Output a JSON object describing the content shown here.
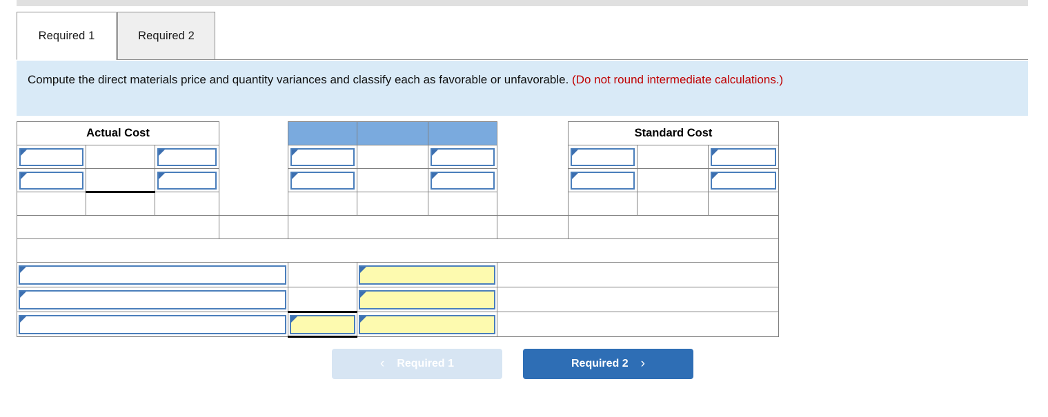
{
  "window": {
    "top_strip": "",
    "tabs": [
      {
        "label": "Required 1",
        "state": "active"
      },
      {
        "label": "Required 2",
        "state": "inactive"
      }
    ]
  },
  "instruction": {
    "text": "Compute the direct materials price and quantity variances and classify each as favorable or unfavorable.",
    "note": "(Do not round intermediate calculations.)"
  },
  "worksheet": {
    "headers": {
      "actual_cost": "Actual Cost",
      "standard_cost": "Standard Cost",
      "blank1": "",
      "blank2": "",
      "blank3": "",
      "spacer1": "",
      "spacer2": ""
    },
    "rows": [
      {
        "name": "input-row-1",
        "cells": [
          {
            "type": "input",
            "value": ""
          },
          {
            "type": "blank",
            "value": ""
          },
          {
            "type": "input",
            "value": ""
          },
          {
            "type": "gap",
            "value": ""
          },
          {
            "type": "input",
            "value": ""
          },
          {
            "type": "blank",
            "value": ""
          },
          {
            "type": "input",
            "value": ""
          },
          {
            "type": "gap",
            "value": ""
          },
          {
            "type": "input",
            "value": ""
          },
          {
            "type": "blank",
            "value": ""
          },
          {
            "type": "input",
            "value": ""
          }
        ]
      },
      {
        "name": "input-row-2",
        "cells": [
          {
            "type": "input",
            "value": ""
          },
          {
            "type": "blank",
            "value": ""
          },
          {
            "type": "input",
            "value": ""
          },
          {
            "type": "gap",
            "value": ""
          },
          {
            "type": "input",
            "value": ""
          },
          {
            "type": "blank",
            "value": ""
          },
          {
            "type": "input",
            "value": ""
          },
          {
            "type": "gap",
            "value": ""
          },
          {
            "type": "input",
            "value": ""
          },
          {
            "type": "blank",
            "value": ""
          },
          {
            "type": "input",
            "value": ""
          }
        ]
      },
      {
        "name": "subtotal-row",
        "cells": [
          {
            "type": "blank",
            "value": ""
          },
          {
            "type": "blank-underlined",
            "value": ""
          },
          {
            "type": "blank",
            "value": ""
          },
          {
            "type": "gap",
            "value": ""
          },
          {
            "type": "blank",
            "value": ""
          },
          {
            "type": "blank",
            "value": ""
          },
          {
            "type": "blank",
            "value": ""
          },
          {
            "type": "gap",
            "value": ""
          },
          {
            "type": "blank",
            "value": ""
          },
          {
            "type": "blank",
            "value": ""
          },
          {
            "type": "blank",
            "value": ""
          }
        ]
      },
      {
        "name": "result-row",
        "cells": [
          {
            "type": "blank-span",
            "value": ""
          },
          {
            "type": "yellow",
            "value": ""
          },
          {
            "type": "blank-span2",
            "value": ""
          },
          {
            "type": "yellow",
            "value": ""
          },
          {
            "type": "blank-span3",
            "value": ""
          }
        ]
      },
      {
        "name": "empty-row",
        "cells": [
          {
            "type": "blank-full",
            "value": ""
          }
        ]
      },
      {
        "name": "variance-row-1",
        "cells": [
          {
            "type": "input-wide",
            "value": ""
          },
          {
            "type": "input-yellow",
            "value": ""
          },
          {
            "type": "input-yellow-wide",
            "value": ""
          },
          {
            "type": "blank",
            "value": ""
          }
        ]
      },
      {
        "name": "variance-row-2",
        "cells": [
          {
            "type": "input-wide",
            "value": ""
          },
          {
            "type": "input-yellow",
            "value": ""
          },
          {
            "type": "input-yellow-wide",
            "value": ""
          },
          {
            "type": "blank",
            "value": ""
          }
        ]
      },
      {
        "name": "variance-row-3",
        "cells": [
          {
            "type": "input-wide",
            "value": ""
          },
          {
            "type": "input-yellow-underlined",
            "value": ""
          },
          {
            "type": "input-yellow-wide",
            "value": ""
          },
          {
            "type": "blank",
            "value": ""
          }
        ]
      }
    ]
  },
  "nav": {
    "prev_label": "Required 1",
    "prev_icon": "chevron-left-icon",
    "prev_glyph": "‹",
    "next_label": "Required 2",
    "next_icon": "chevron-right-icon",
    "next_glyph": "›"
  },
  "colors": {
    "header_blue": "#7aaade",
    "input_border_blue": "#4a7ebb",
    "yellow_fill": "#fdfaaf",
    "banner_blue": "#d9eaf7",
    "note_red": "#c00000",
    "button_blue": "#2e6eb5",
    "button_disabled": "#d7e5f3"
  }
}
